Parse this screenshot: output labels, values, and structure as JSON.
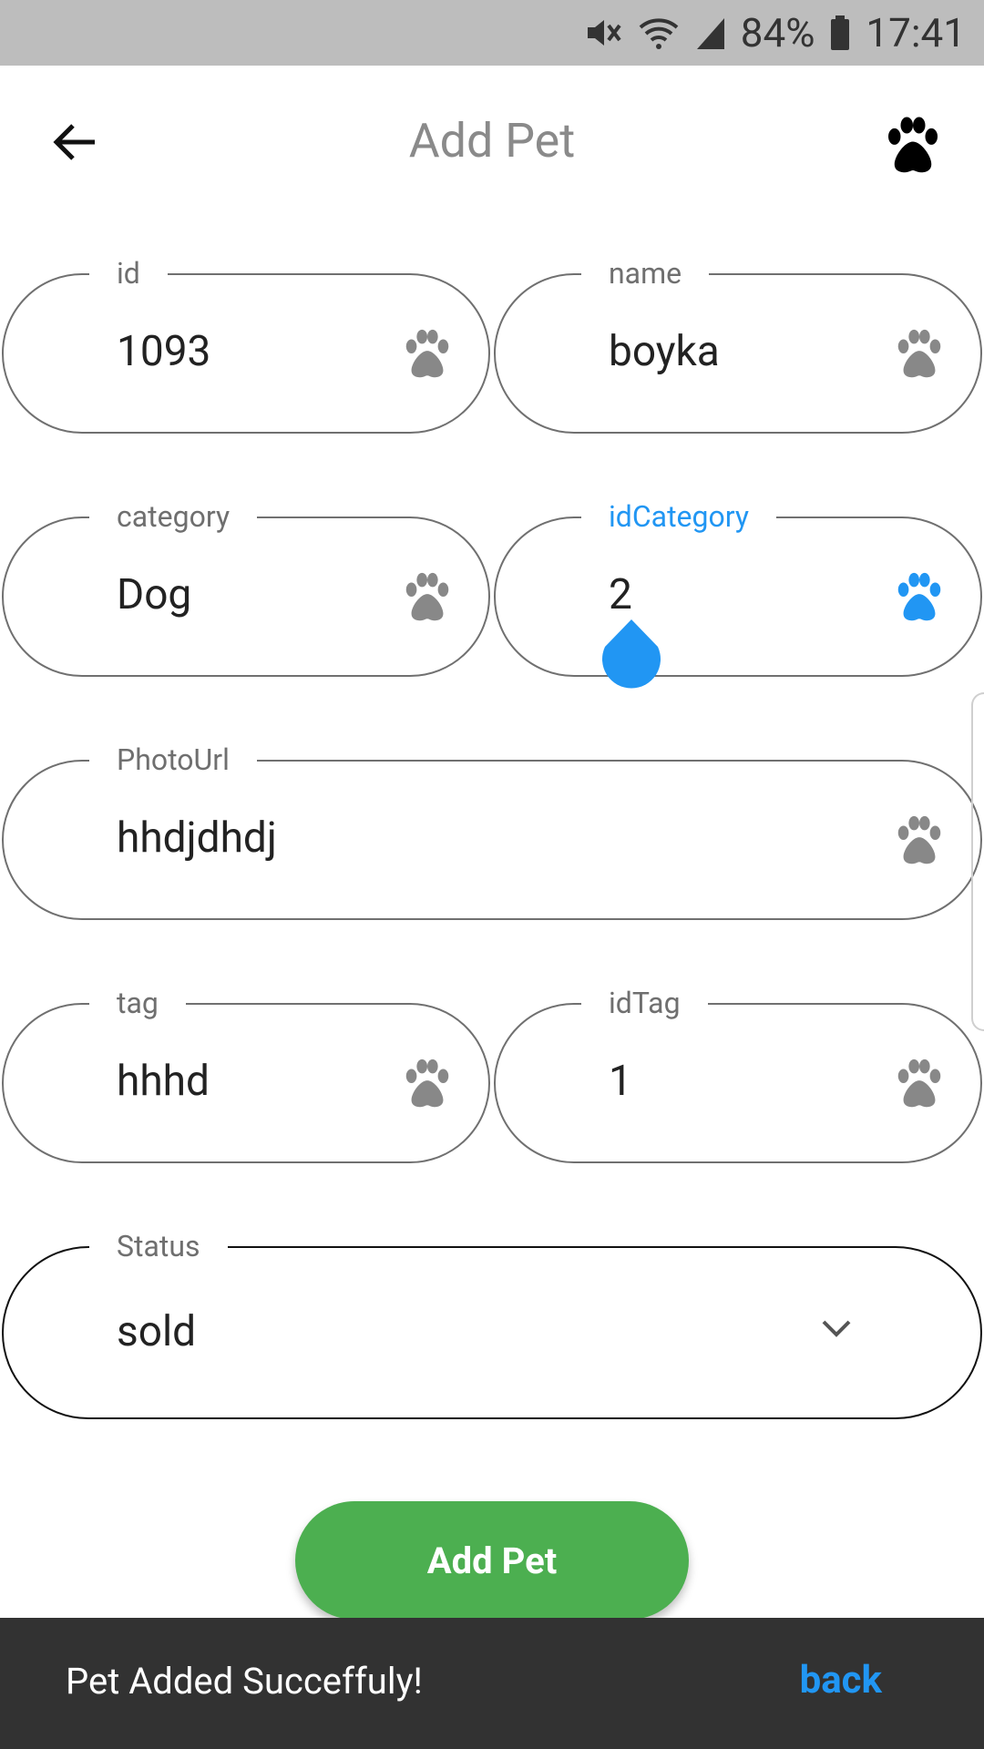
{
  "status_bar": {
    "battery": "84%",
    "time": "17:41"
  },
  "appbar": {
    "title": "Add Pet"
  },
  "fields": {
    "id": {
      "label": "id",
      "value": "1093"
    },
    "name": {
      "label": "name",
      "value": "boyka"
    },
    "category": {
      "label": "category",
      "value": "Dog"
    },
    "idCategory": {
      "label": "idCategory",
      "value": "2"
    },
    "photoUrl": {
      "label": "PhotoUrl",
      "value": "hhdjdhdj"
    },
    "tag": {
      "label": "tag",
      "value": "hhhd"
    },
    "idTag": {
      "label": "idTag",
      "value": "1"
    },
    "status": {
      "label": "Status",
      "value": "sold"
    }
  },
  "add_button": {
    "label": "Add Pet"
  },
  "snackbar": {
    "message": "Pet Added Succeffuly!",
    "action": "back"
  },
  "icons": {
    "paw": "paw-icon",
    "back": "arrow-left-icon",
    "dropdown": "chevron-down-icon"
  },
  "colors": {
    "accent": "#2196f3",
    "button": "#4caf50",
    "snackbar": "#323232",
    "statusbar": "#bdbdbd"
  }
}
